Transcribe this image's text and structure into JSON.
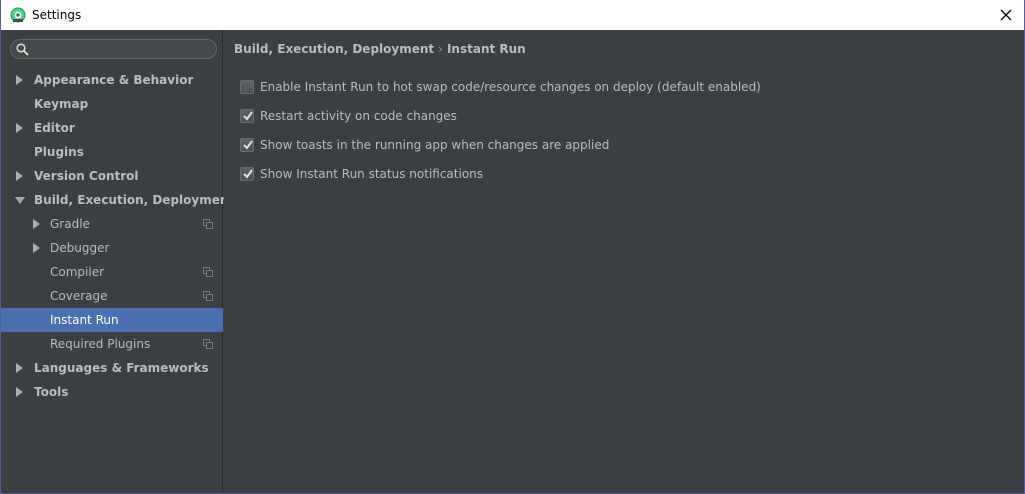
{
  "window": {
    "title": "Settings"
  },
  "search": {
    "value": "",
    "placeholder": ""
  },
  "tree": {
    "appearance": "Appearance & Behavior",
    "keymap": "Keymap",
    "editor": "Editor",
    "plugins": "Plugins",
    "version_control": "Version Control",
    "build": "Build, Execution, Deployment",
    "gradle": "Gradle",
    "debugger": "Debugger",
    "compiler": "Compiler",
    "coverage": "Coverage",
    "instant_run": "Instant Run",
    "required_plugins": "Required Plugins",
    "languages": "Languages & Frameworks",
    "tools": "Tools"
  },
  "breadcrumb": {
    "parent": "Build, Execution, Deployment",
    "separator": "›",
    "current": "Instant Run"
  },
  "options": [
    {
      "label": "Enable Instant Run to hot swap code/resource changes on deploy (default enabled)",
      "checked": false
    },
    {
      "label": "Restart activity on code changes",
      "checked": true
    },
    {
      "label": "Show toasts in the running app when changes are applied",
      "checked": true
    },
    {
      "label": "Show Instant Run status notifications",
      "checked": true
    }
  ],
  "colors": {
    "background": "#3c3f41",
    "selection": "#4b6eaf",
    "text": "#bbbbbb",
    "titlebar": "#ffffff"
  }
}
